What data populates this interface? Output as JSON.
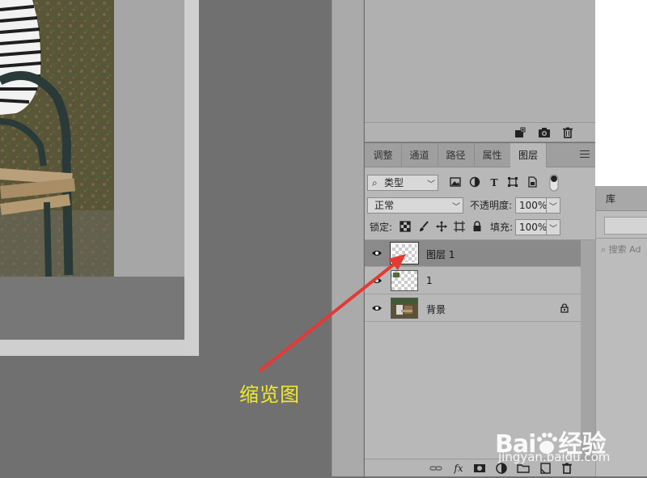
{
  "panels_top_footer": {
    "icons": [
      "new-snapshot-icon",
      "camera-icon",
      "trash-icon"
    ]
  },
  "tabs": [
    {
      "label": "调整"
    },
    {
      "label": "通道"
    },
    {
      "label": "路径"
    },
    {
      "label": "属性"
    },
    {
      "label": "图层",
      "active": true
    }
  ],
  "filter": {
    "kind_label": "类型",
    "icons": [
      "image-filter-icon",
      "adjustment-filter-icon",
      "type-filter-icon",
      "shape-filter-icon",
      "smart-object-filter-icon",
      "filter-toggle-icon"
    ]
  },
  "blend": {
    "mode": "正常",
    "opacity_label": "不透明度:",
    "opacity_value": "100%"
  },
  "lock": {
    "label": "锁定:",
    "icons": [
      "lock-transparent-icon",
      "lock-paint-icon",
      "lock-move-icon",
      "lock-artboard-icon",
      "lock-all-icon"
    ],
    "fill_label": "填充:",
    "fill_value": "100%"
  },
  "layers": [
    {
      "name": "图层 1",
      "selected": true,
      "thumb": "transparent"
    },
    {
      "name": "1",
      "selected": false,
      "thumb": "transparent-with-content"
    },
    {
      "name": "背景",
      "selected": false,
      "thumb": "photo",
      "locked": true
    }
  ],
  "bottom_bar": {
    "icons": [
      "link-icon",
      "fx-icon",
      "mask-icon",
      "adjustment-icon",
      "folder-icon",
      "new-layer-icon",
      "trash-icon"
    ],
    "fx_label": "fx"
  },
  "library": {
    "tab_label": "库",
    "search_placeholder": "搜索 Ad"
  },
  "annotation": {
    "text": "缩览图",
    "color": "#f1ea2c",
    "arrow_color": "#e53935"
  },
  "watermark": {
    "brand": "Bai",
    "brand_suffix": "经验",
    "url": "jingyan.baidu.com"
  }
}
